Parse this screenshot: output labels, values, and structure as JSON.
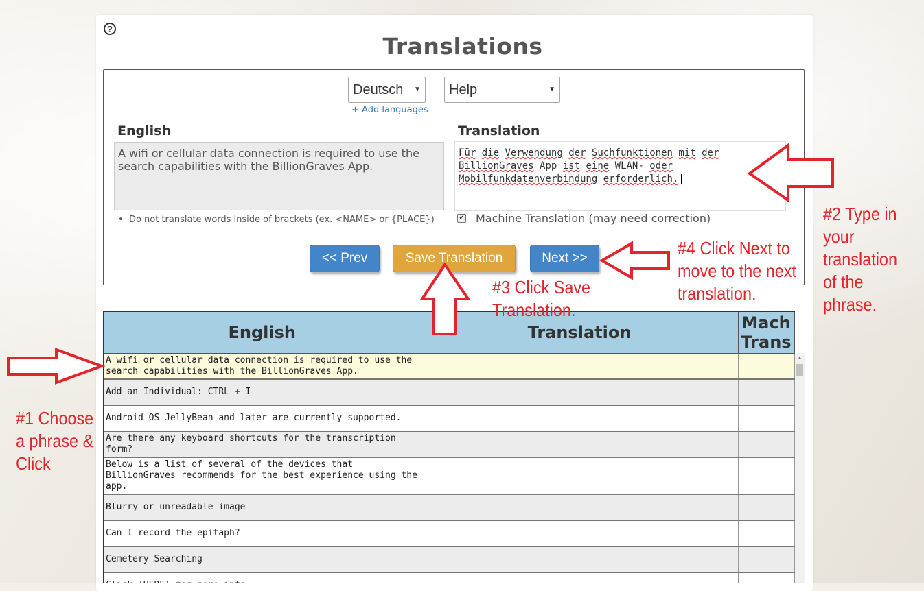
{
  "page": {
    "title": "Translations"
  },
  "language_select": {
    "selected": "Deutsch"
  },
  "category_select": {
    "selected": "Help"
  },
  "add_languages": "+ Add languages",
  "source": {
    "heading": "English",
    "text": "A wifi or cellular data connection is required to use the search capabilities with the BillionGraves App.",
    "hint": "Do not translate words inside of brackets (ex. <NAME> or {PLACE})"
  },
  "target": {
    "heading": "Translation",
    "text": "Für die Verwendung der Suchfunktionen mit der BillionGraves App ist eine WLAN- oder Mobilfunkdatenverbindung erforderlich.",
    "machine_translation_label": "Machine Translation (may need correction)",
    "machine_translation_checked": true
  },
  "buttons": {
    "prev": "<< Prev",
    "save": "Save Translation",
    "next": "Next >>"
  },
  "annotations": {
    "step1": [
      "#1 Choose",
      "a phrase &",
      "Click"
    ],
    "step2": [
      "#2 Type in",
      "your",
      "translation",
      "of the",
      "phrase."
    ],
    "step3": [
      "#3 Click Save",
      "Translation."
    ],
    "step4": [
      "#4 Click Next to",
      "move to the next",
      "translation."
    ]
  },
  "table": {
    "headers": {
      "english": "English",
      "translation": "Translation",
      "mach_line1": "Mach",
      "mach_line2": "Trans"
    },
    "rows": [
      {
        "english": "A wifi or cellular data connection is required to use the search capabilities with the BillionGraves App.",
        "translation": "",
        "mach": ""
      },
      {
        "english": "Add an Individual: CTRL + I",
        "translation": "",
        "mach": ""
      },
      {
        "english": "Android OS JellyBean and later are currently supported.",
        "translation": "",
        "mach": ""
      },
      {
        "english": "Are there any keyboard shortcuts for the transcription form?",
        "translation": "",
        "mach": ""
      },
      {
        "english": "Below is a list of several of the devices that BillionGraves recommends for the best experience using the app.",
        "translation": "",
        "mach": ""
      },
      {
        "english": "Blurry or unreadable image",
        "translation": "",
        "mach": ""
      },
      {
        "english": "Can I record the epitaph?",
        "translation": "",
        "mach": ""
      },
      {
        "english": "Cemetery Searching",
        "translation": "",
        "mach": ""
      },
      {
        "english": "Click {HERE} for more info.",
        "translation": "",
        "mach": ""
      }
    ]
  },
  "colors": {
    "annotation_red": "#e3242b",
    "header_blue": "#a6cfe3",
    "selected_row": "#fcfbdc",
    "btn_blue": "#4285c9",
    "btn_orange": "#e0a53c"
  },
  "icons": {
    "help": "question-circle-icon"
  }
}
